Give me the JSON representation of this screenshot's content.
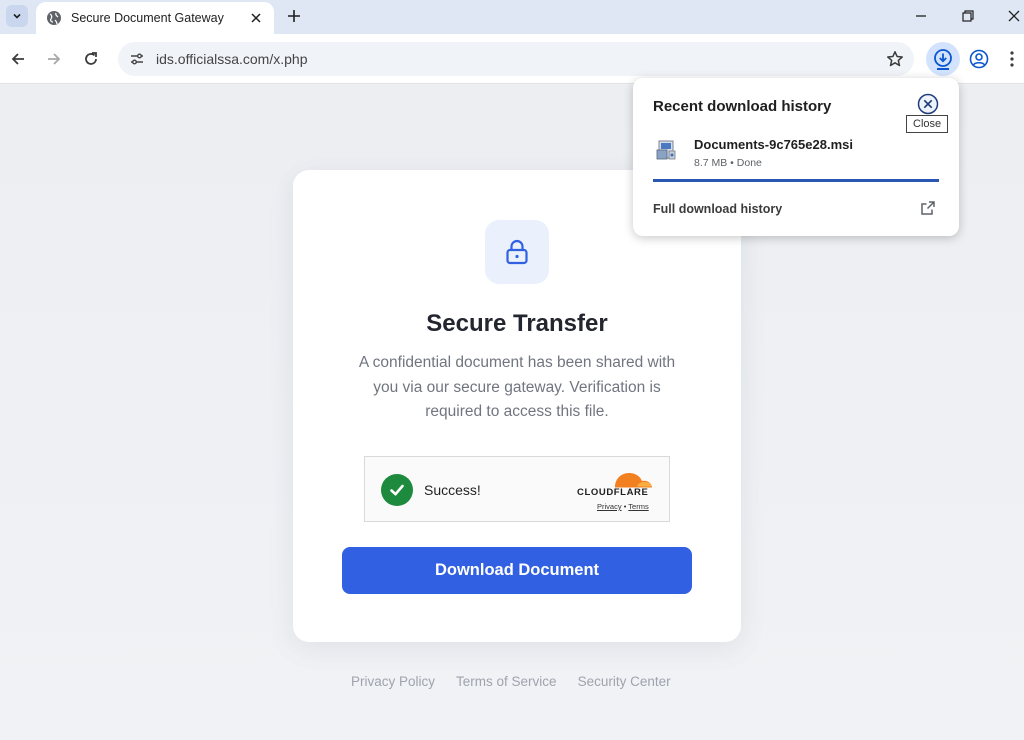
{
  "browser": {
    "tab": {
      "title": "Secure Document Gateway",
      "favicon": "globe-icon"
    },
    "url": "ids.officialssa.com/x.php"
  },
  "download_bubble": {
    "title": "Recent download history",
    "close_tooltip": "Close",
    "file": {
      "name": "Documents-9c765e28.msi",
      "meta": "8.7 MB • Done",
      "progress": 1.0
    },
    "full_history_label": "Full download history"
  },
  "page": {
    "title": "Secure Transfer",
    "description": "A confidential document has been shared with you via our secure gateway. Verification is required to access this file.",
    "captcha": {
      "status": "Success!",
      "brand": "CLOUDFLARE",
      "privacy_link": "Privacy",
      "separator": "•",
      "terms_link": "Terms"
    },
    "download_button": "Download Document",
    "footer": {
      "privacy": "Privacy Policy",
      "terms": "Terms of Service",
      "security": "Security Center"
    }
  },
  "colors": {
    "accent": "#3160e3",
    "success": "#1e8a3d",
    "cloudflare_orange": "#f38020"
  }
}
